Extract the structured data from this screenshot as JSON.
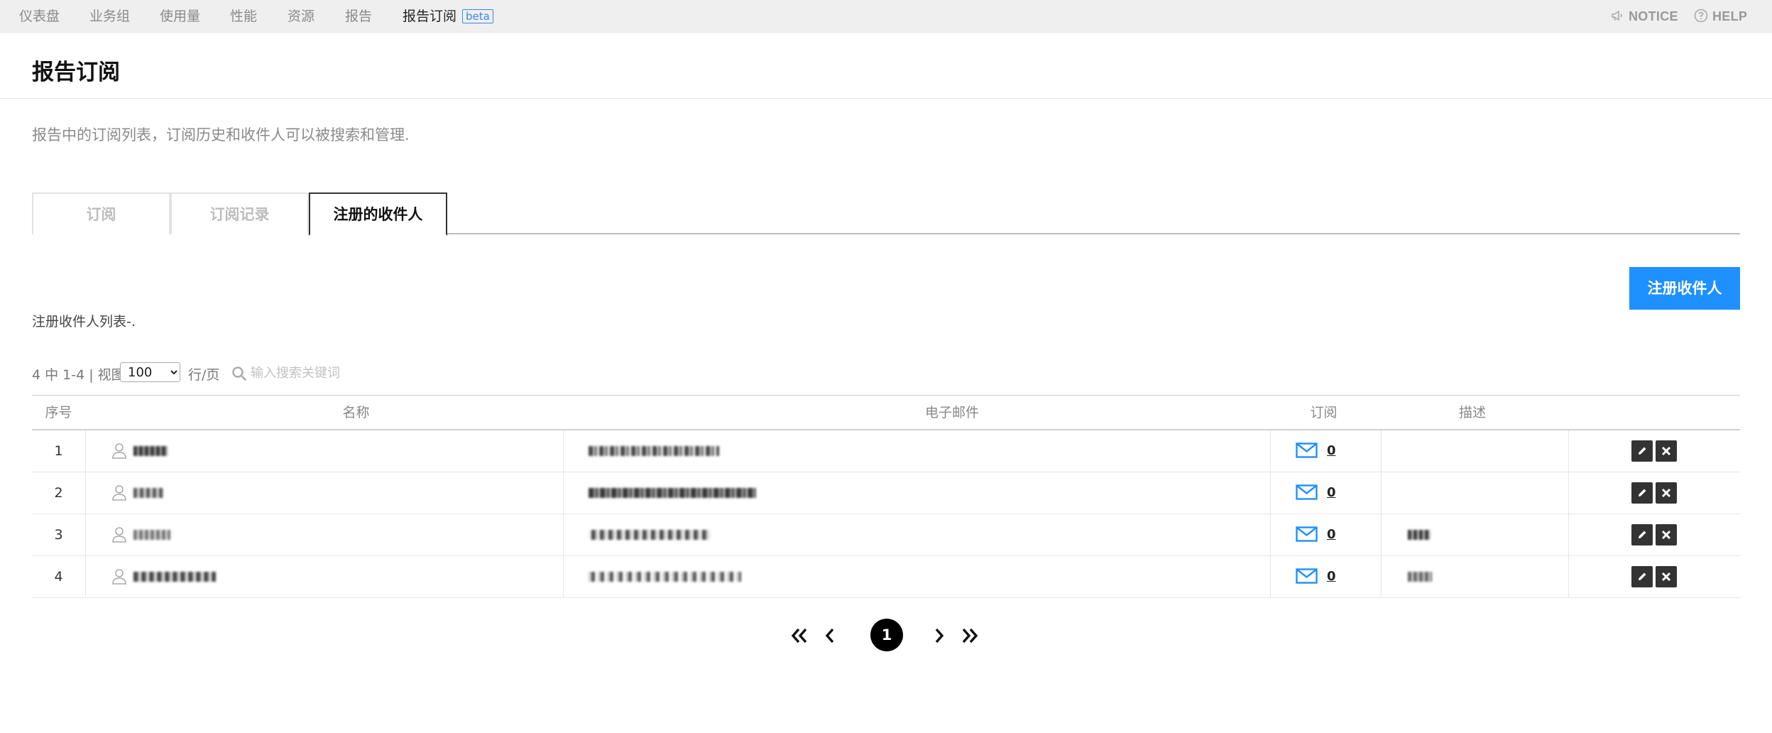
{
  "nav": {
    "items": [
      "仪表盘",
      "业务组",
      "使用量",
      "性能",
      "资源",
      "报告",
      "报告订阅"
    ],
    "beta_badge": "beta",
    "notice": "NOTICE",
    "help": "HELP"
  },
  "page": {
    "title": "报告订阅",
    "description": "报告中的订阅列表，订阅历史和收件人可以被搜索和管理."
  },
  "tabs": [
    "订阅",
    "订阅记录",
    "注册的收件人"
  ],
  "register_button": "注册收件人",
  "list_description": "注册收件人列表-.",
  "toolbar": {
    "count_text": "4 中 1-4 | 视图",
    "rows_per_page": "100",
    "rows_per_page_options": [
      "100"
    ],
    "per_page_label": "行/页",
    "search_placeholder": "输入搜索关键词"
  },
  "table": {
    "headers": [
      "序号",
      "名称",
      "电子邮件",
      "订阅",
      "描述"
    ],
    "rows": [
      {
        "index": "1",
        "subscriptions": "0"
      },
      {
        "index": "2",
        "subscriptions": "0"
      },
      {
        "index": "3",
        "subscriptions": "0"
      },
      {
        "index": "4",
        "subscriptions": "0"
      }
    ]
  },
  "pagination": {
    "current_page": "1"
  },
  "colors": {
    "accent": "#1e90ff",
    "mail_icon": "#1e90ff",
    "action_button": "#333333"
  }
}
